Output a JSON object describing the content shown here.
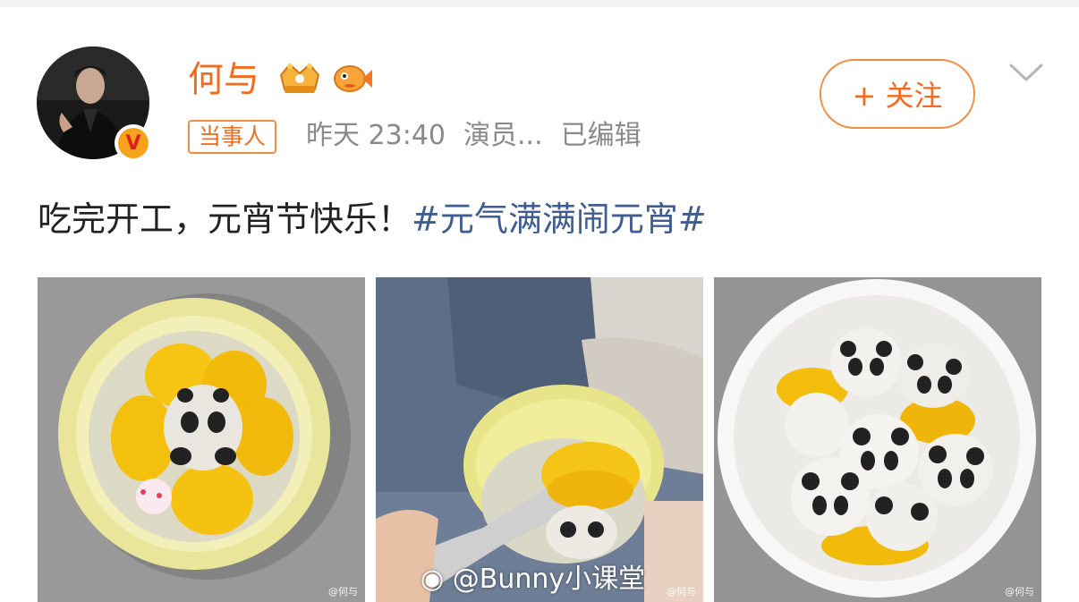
{
  "user": {
    "name": "何与",
    "avatar_icon": "avatar-portrait",
    "verified_badge": "V",
    "badges": [
      "crown-badge-icon",
      "fish-badge-icon"
    ]
  },
  "meta": {
    "tag": "当事人",
    "time": "昨天 23:40",
    "source": "演员...",
    "edited": "已编辑"
  },
  "actions": {
    "follow_label": "+ 关注",
    "more_icon": "chevron-down-icon"
  },
  "post": {
    "text": "吃完开工，元宵节快乐！",
    "hashtag": "#元气满满闹元宵#"
  },
  "images": [
    {
      "watermark": "@何与"
    },
    {
      "watermark": "@何与",
      "overlay": "@Bunny小课堂"
    },
    {
      "watermark": "@何与"
    }
  ],
  "colors": {
    "accent": "#f06d1f",
    "hashtag": "#3f5e8f",
    "meta": "#8a8a8a"
  }
}
